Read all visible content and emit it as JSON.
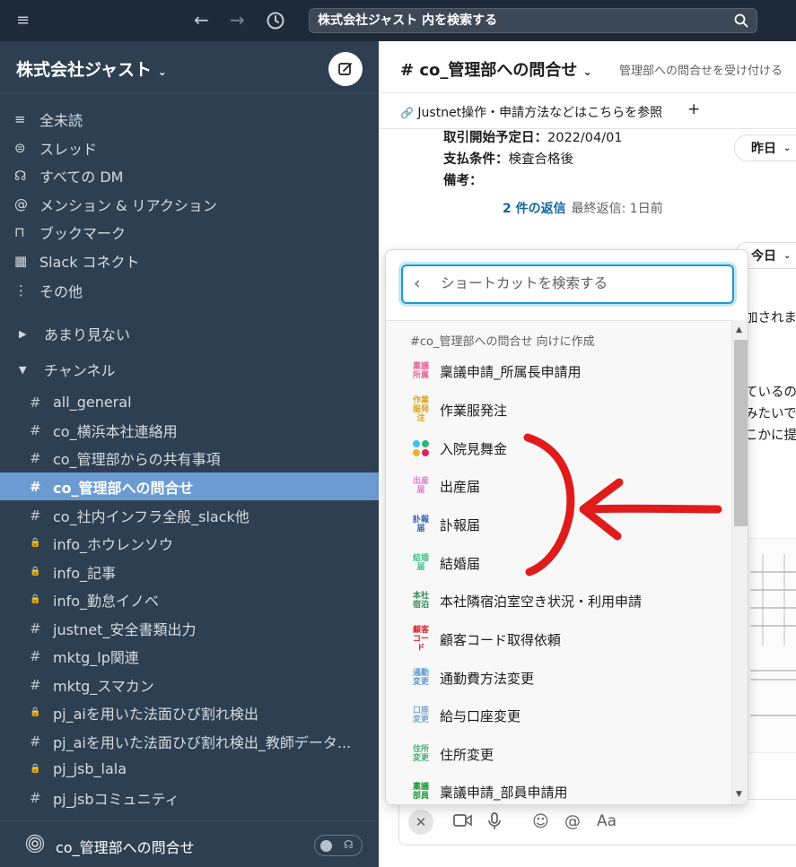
{
  "search": {
    "value": "株式会社ジャスト 内を検索する"
  },
  "workspace": {
    "name": "株式会社ジャスト"
  },
  "sidebar": {
    "nav": [
      {
        "label": "全未読",
        "icon": "≡"
      },
      {
        "label": "スレッド",
        "icon": "⊜"
      },
      {
        "label": "すべての DM",
        "icon": "☊"
      },
      {
        "label": "メンション & リアクション",
        "icon": "@"
      },
      {
        "label": "ブックマーク",
        "icon": "⊓"
      },
      {
        "label": "Slack コネクト",
        "icon": "▦"
      },
      {
        "label": "その他",
        "icon": "⋮"
      }
    ],
    "section_less": "あまり見ない",
    "section_channels": "チャンネル",
    "channels": [
      {
        "label": "all_general",
        "icon": "#"
      },
      {
        "label": "co_横浜本社連絡用",
        "icon": "#"
      },
      {
        "label": "co_管理部からの共有事項",
        "icon": "#"
      },
      {
        "label": "co_管理部への問合せ",
        "icon": "#"
      },
      {
        "label": "co_社内インフラ全般_slack他",
        "icon": "#"
      },
      {
        "label": "info_ホウレンソウ",
        "icon": "🔒"
      },
      {
        "label": "info_記事",
        "icon": "🔒"
      },
      {
        "label": "info_勤怠イノベ",
        "icon": "🔒"
      },
      {
        "label": "justnet_安全書類出力",
        "icon": "#"
      },
      {
        "label": "mktg_lp関連",
        "icon": "#"
      },
      {
        "label": "mktg_スマカン",
        "icon": "#"
      },
      {
        "label": "pj_aiを用いた法面ひび割れ検出",
        "icon": "🔒"
      },
      {
        "label": "pj_aiを用いた法面ひび割れ検出_教師データ...",
        "icon": "#"
      },
      {
        "label": "pj_jsb_lala",
        "icon": "🔒"
      },
      {
        "label": "pj_jsbコミュニティ",
        "icon": "#"
      }
    ],
    "footer": "co_管理部への問合せ"
  },
  "channel": {
    "title": "# co_管理部への問合せ",
    "topic": "管理部への問合せを受け付ける",
    "bookmark": "Justnet操作・申請方法などはこちらを参照",
    "bookmark_add": "+"
  },
  "message": {
    "line1_label": "取引開始予定日：",
    "line1_value": "2022/04/01",
    "line2_label": "支払条件：",
    "line2_value": "検査合格後",
    "line3_label": "備考：",
    "reply_count": "2 件の返信",
    "last_reply": "最終返信: 1日前"
  },
  "day_labels": {
    "yesterday": "昨日",
    "today": "今日"
  },
  "partial_text": [
    "加されま",
    "ているの",
    "みたいで",
    "こかに提"
  ],
  "popup": {
    "placeholder": "ショートカットを検索する",
    "section": "#co_管理部への問合せ 向けに作成",
    "items": [
      {
        "label": "稟議申請_所属長申請用",
        "icon_text": "稟議所属",
        "color": "#e8689a"
      },
      {
        "label": "作業服発注",
        "icon_text": "作業服発注",
        "color": "#e0a21a"
      },
      {
        "label": "入院見舞金",
        "icon_text": "",
        "color": "#36c5f0"
      },
      {
        "label": "出産届",
        "icon_text": "出産届",
        "color": "#e07ad8"
      },
      {
        "label": "訃報届",
        "icon_text": "訃報届",
        "color": "#2f5fb3"
      },
      {
        "label": "結婚届",
        "icon_text": "結婚届",
        "color": "#3cc48a"
      },
      {
        "label": "本社隣宿泊室空き状況・利用申請",
        "icon_text": "本社宿泊",
        "color": "#2e8b57"
      },
      {
        "label": "顧客コード取得依頼",
        "icon_text": "顧客コード",
        "color": "#d9262c"
      },
      {
        "label": "通勤費方法変更",
        "icon_text": "通勤変更",
        "color": "#5b9bd5"
      },
      {
        "label": "給与口座変更",
        "icon_text": "口座変更",
        "color": "#7aa7d6"
      },
      {
        "label": "住所変更",
        "icon_text": "住所変更",
        "color": "#4caf7a"
      },
      {
        "label": "稟議申請_部員申請用",
        "icon_text": "稟議部員",
        "color": "#1e9b3a"
      }
    ]
  }
}
